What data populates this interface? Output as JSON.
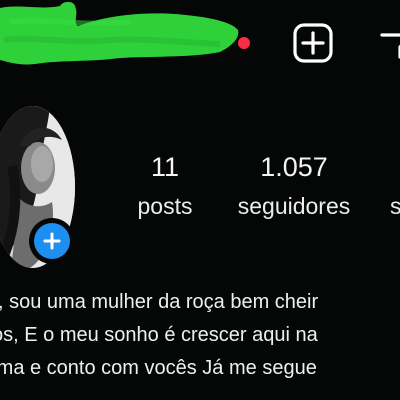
{
  "header": {
    "username_redacted": true,
    "redaction_color": "#2fd13a",
    "notification_dot_color": "#ff2b45",
    "icons": [
      "create-post-icon",
      "menu-icon"
    ]
  },
  "profile": {
    "avatar_icon": "avatar-photo",
    "add_story_icon": "plus-icon",
    "add_story_color": "#1f8ef1"
  },
  "stats": {
    "posts": {
      "count": "11",
      "label": "posts"
    },
    "followers": {
      "count": "1.057",
      "label": "seguidores"
    },
    "following": {
      "label_partial": "s"
    }
  },
  "bio": {
    "lines": [
      ", sou uma mulher da roça bem cheir",
      "os, E o meu sonho é crescer aqui na",
      "rma e conto com vocês Já me segue"
    ]
  }
}
